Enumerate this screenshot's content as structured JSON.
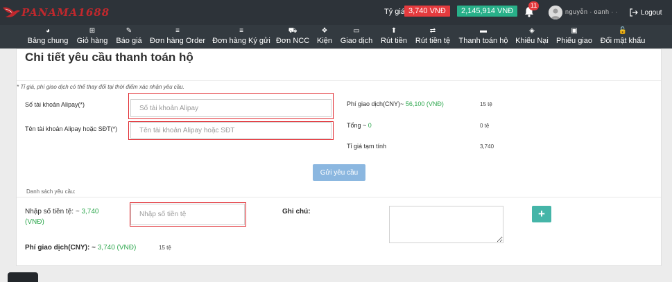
{
  "brand": {
    "name": "PANAMA1688",
    "color": "#c0282d"
  },
  "header": {
    "rate_label": "Tỷ giá:",
    "rate_value": "3,740 VNĐ",
    "balance": "2,145,914 VNĐ",
    "notification_count": "11",
    "username": "nguyễn ∙ oanh ∙ ∙",
    "logout_label": "Logout"
  },
  "nav": [
    {
      "label": "Bảng chung",
      "icon": "dashboard-icon",
      "glyph": "◕"
    },
    {
      "label": "Giỏ hàng",
      "icon": "cart-icon",
      "glyph": "⊞"
    },
    {
      "label": "Báo giá",
      "icon": "quote-icon",
      "glyph": "✎"
    },
    {
      "label": "Đơn hàng Order",
      "icon": "list-icon",
      "glyph": "≡"
    },
    {
      "label": "Đơn hàng Ký gửi",
      "icon": "list-icon",
      "glyph": "≡"
    },
    {
      "label": "Đơn NCC",
      "icon": "truck-icon",
      "glyph": "⛟"
    },
    {
      "label": "Kiện",
      "icon": "boxes-icon",
      "glyph": "❖"
    },
    {
      "label": "Giao dịch",
      "icon": "card-icon",
      "glyph": "▭"
    },
    {
      "label": "Rút tiền",
      "icon": "arrow-up-icon",
      "glyph": "⬆"
    },
    {
      "label": "Rút tiền tệ",
      "icon": "exchange-icon",
      "glyph": "⇄"
    },
    {
      "label": "Thanh toán hộ",
      "icon": "credit-card-icon",
      "glyph": "▬"
    },
    {
      "label": "Khiếu Nại",
      "icon": "tag-icon",
      "glyph": "◈"
    },
    {
      "label": "Phiếu giao",
      "icon": "document-icon",
      "glyph": "▣"
    },
    {
      "label": "Đổi mật khẩu",
      "icon": "unlock-icon",
      "glyph": "🔓"
    }
  ],
  "page": {
    "title": "Chi tiết yêu cầu thanh toán hộ",
    "note": "* Tỉ giá, phí giao dịch có thể thay đổi tại thời điểm xác nhận yêu cầu."
  },
  "form": {
    "alipay_account_label": "Số tài khoản Alipay(*)",
    "alipay_account_placeholder": "Số tài khoản Alipay",
    "alipay_name_label": "Tên tài khoản Alipay hoặc SĐT(*)",
    "alipay_name_placeholder": "Tên tài khoản Alipay hoặc SĐT",
    "submit_label": "Gửi yêu cầu"
  },
  "summary": {
    "fee_label": "Phí giao dịch(CNY)~",
    "fee_vnd": "56,100 (VNĐ)",
    "fee_cny": "15  tệ",
    "total_label": "Tổng ~",
    "total_vnd": "0",
    "total_cny": "0 tệ",
    "temp_rate_label": "Tỉ giá tạm tính",
    "temp_rate_value": "3,740"
  },
  "list": {
    "label": "Danh sách yêu cầu:",
    "amount_label": "Nhập số tiền tệ: ~",
    "amount_rate": "3,740 (VNĐ)",
    "amount_placeholder": "Nhập số tiền tệ",
    "notes_label": "Ghi chú:",
    "add_label": "+",
    "fee_label": "Phí giao dịch(CNY): ~",
    "fee_rate": "3,740 (VNĐ)",
    "fee_value": "15 tệ"
  },
  "colors": {
    "header_bg": "#2d3339",
    "nav_bg": "#333a40",
    "rate_badge": "#e53b3e",
    "balance_badge": "#28b089",
    "highlight": "#e0252b",
    "green_text": "#2fa84f",
    "submit_button": "#8bb7e0",
    "add_button": "#45b5a8"
  }
}
